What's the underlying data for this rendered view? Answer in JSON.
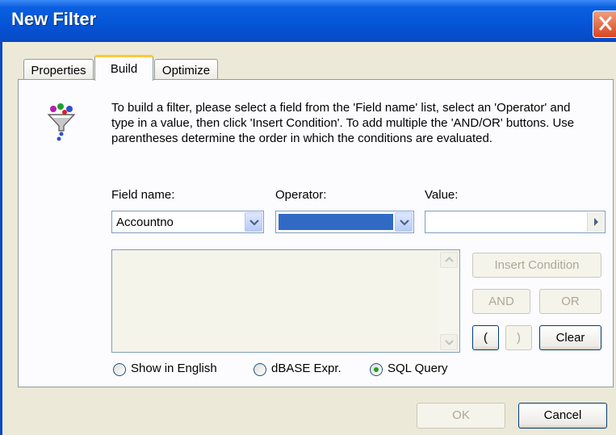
{
  "window": {
    "title": "New Filter"
  },
  "tabs": [
    {
      "label": "Properties",
      "active": false
    },
    {
      "label": "Build",
      "active": true
    },
    {
      "label": "Optimize",
      "active": false
    }
  ],
  "build": {
    "description": "To build a filter, please select a field from the 'Field name' list, select an 'Operator'  and type in a value, then click 'Insert Condition'. To add multiple the 'AND/OR' buttons.  Use parentheses determine the order in which the conditions are evaluated.",
    "field_name_label": "Field name:",
    "operator_label": "Operator:",
    "value_label": "Value:",
    "field_name_value": "Accountno",
    "operator_value": "",
    "value_value": "",
    "insert_condition_label": "Insert Condition",
    "and_label": "AND",
    "or_label": "OR",
    "open_paren_label": "(",
    "close_paren_label": ")",
    "clear_label": "Clear",
    "condition_text": "",
    "radio_options": [
      {
        "label": "Show in English",
        "selected": false
      },
      {
        "label": "dBASE Expr.",
        "selected": false
      },
      {
        "label": "SQL Query",
        "selected": true
      }
    ]
  },
  "footer": {
    "ok_label": "OK",
    "cancel_label": "Cancel"
  },
  "colors": {
    "titlebar": "#0554d6",
    "selection": "#316ac5",
    "radio_selected": "#21a121"
  }
}
